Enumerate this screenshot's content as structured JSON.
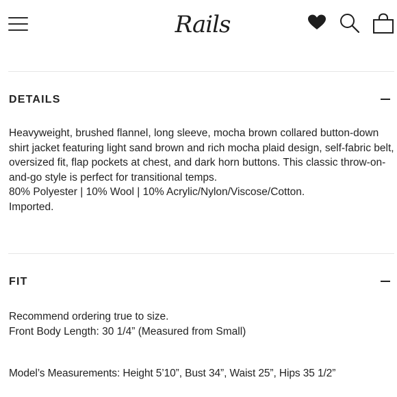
{
  "header": {
    "menu_icon": "hamburger-menu-icon",
    "logo_text": "Rails",
    "icons": [
      "heart-icon",
      "search-icon",
      "shopping-bag-icon"
    ]
  },
  "details": {
    "title": "DETAILS",
    "toggle_symbol": "minus",
    "description": "Heavyweight, brushed flannel, long sleeve, mocha brown collared button-down shirt jacket featuring light sand brown and rich mocha plaid design, self-fabric belt, oversized fit, flap pockets at chest, and dark horn buttons. This classic throw-on-and-go style is perfect for transitional temps.",
    "composition": "80% Polyester | 10% Wool | 10% Acrylic/Nylon/Viscose/Cotton.",
    "origin": "Imported."
  },
  "fit": {
    "title": "FIT",
    "toggle_symbol": "minus",
    "recommendation": "Recommend ordering true to size.",
    "length": "Front Body Length: 30 1/4” (Measured from Small)",
    "model_measurements": "Model’s Measurements: Height 5’10”, Bust 34”, Waist 25”, Hips 35 1/2”"
  }
}
